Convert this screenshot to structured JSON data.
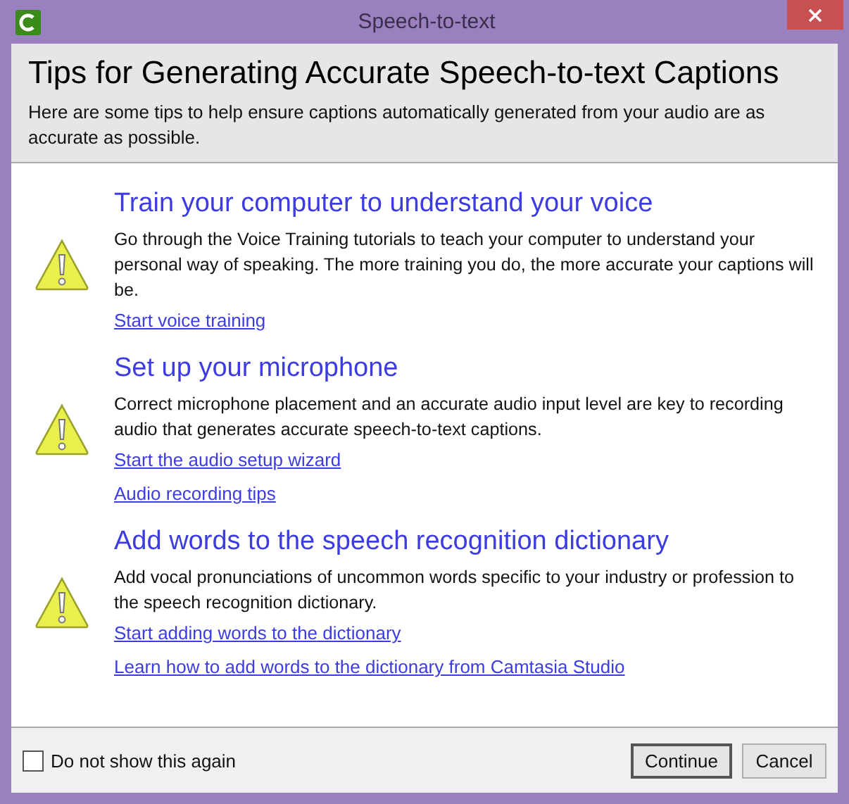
{
  "window": {
    "title": "Speech-to-text"
  },
  "header": {
    "title": "Tips for Generating Accurate Speech-to-text Captions",
    "description": "Here are some tips to help ensure captions automatically generated from your audio are as accurate as possible."
  },
  "sections": [
    {
      "heading": "Train your computer to understand your voice",
      "text": "Go through the Voice Training tutorials to teach your computer to understand your personal way of speaking. The more training you do, the more accurate your captions will be.",
      "links": [
        "Start voice training"
      ]
    },
    {
      "heading": "Set up your microphone",
      "text": "Correct microphone placement and an accurate audio input level are key to recording audio that generates accurate speech-to-text captions.",
      "links": [
        "Start the audio setup wizard",
        "Audio recording tips"
      ]
    },
    {
      "heading": "Add words to the speech recognition dictionary",
      "text": "Add vocal pronunciations of uncommon words specific to your industry or profession to the speech recognition dictionary.",
      "links": [
        "Start adding words to the dictionary",
        "Learn how to add words to the dictionary from Camtasia Studio"
      ]
    }
  ],
  "footer": {
    "checkbox": {
      "label": "Do not show this again",
      "checked": false
    },
    "buttons": [
      {
        "label": "Continue",
        "default": true
      },
      {
        "label": "Cancel",
        "default": false
      }
    ]
  }
}
